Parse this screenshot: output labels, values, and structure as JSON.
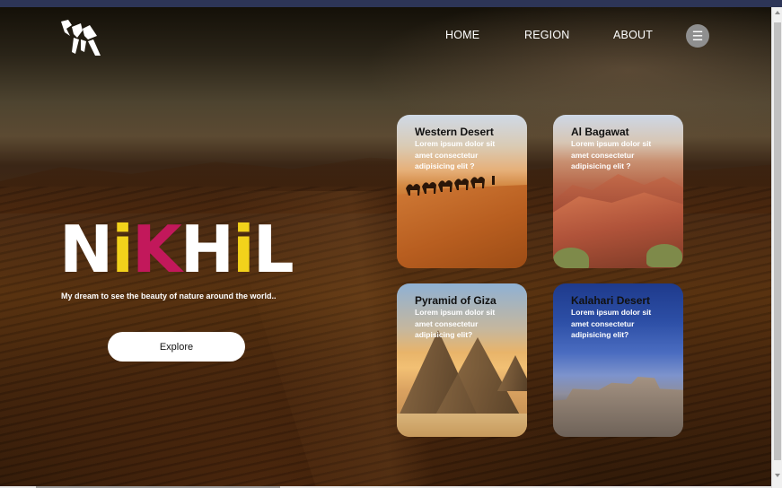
{
  "nav": {
    "logo_icon": "camel-logo-icon",
    "home": "HOME",
    "region": "REGION",
    "about": "ABOUT",
    "menu_icon": "hamburger-menu-icon",
    "menu_glyph": "☰"
  },
  "hero": {
    "brand_letters": [
      {
        "char": "N",
        "color": "#ffffff"
      },
      {
        "char": "i",
        "color": "#f2d21b"
      },
      {
        "char": "K",
        "color": "#c2185b"
      },
      {
        "char": "H",
        "color": "#ffffff"
      },
      {
        "char": "i",
        "color": "#f2d21b"
      },
      {
        "char": "L",
        "color": "#ffffff"
      }
    ],
    "tagline": "My dream to see the beauty of nature around the world..",
    "explore_label": "Explore"
  },
  "cards": [
    {
      "title": "Western Desert",
      "text": "Lorem ipsum dolor sit amet consectetur adipisicing elit ?"
    },
    {
      "title": "Al Bagawat",
      "text": "Lorem ipsum dolor sit amet consectetur adipisicing elit ?"
    },
    {
      "title": "Pyramid of Giza",
      "text": "Lorem ipsum dolor sit amet consectetur adipisicing elit?"
    },
    {
      "title": "Kalahari Desert",
      "text": "Lorem ipsum dolor sit amet consectetur adipisicing elit?"
    }
  ],
  "colors": {
    "accent_yellow": "#f2d21b",
    "accent_pink": "#c2185b",
    "button_bg": "#ffffff",
    "menu_button_bg": "#8f8f8f"
  }
}
